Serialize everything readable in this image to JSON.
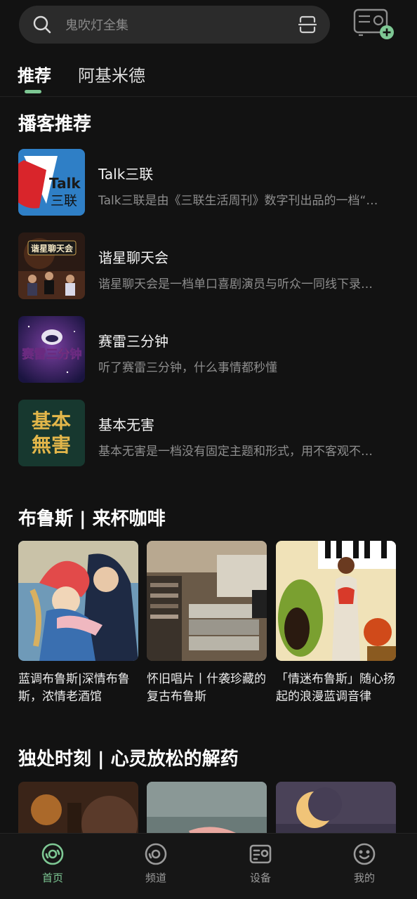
{
  "search": {
    "placeholder": "鬼吹灯全集"
  },
  "tabs": [
    {
      "label": "推荐",
      "active": true
    },
    {
      "label": "阿基米德",
      "active": false
    }
  ],
  "podcast_section": {
    "title": "播客推荐",
    "items": [
      {
        "title": "Talk三联",
        "desc": "Talk三联是由《三联生活周刊》数字刊出品的一档“…",
        "cover_text": "Talk三联"
      },
      {
        "title": "谐星聊天会",
        "desc": "谐星聊天会是一档单口喜剧演员与听众一同线下录…",
        "cover_text": "谐星聊天会"
      },
      {
        "title": "赛雷三分钟",
        "desc": "听了赛雷三分钟，什么事情都秒懂",
        "cover_text": "赛雷三分钟"
      },
      {
        "title": "基本无害",
        "desc": "基本无害是一档没有固定主题和形式，用不客观不…",
        "cover_text_line1": "基本",
        "cover_text_line2": "無害"
      }
    ]
  },
  "blues_section": {
    "title": "布鲁斯 | 来杯咖啡",
    "cards": [
      {
        "title": "蓝调布鲁斯|深情布鲁斯，浓情老酒馆"
      },
      {
        "title": "怀旧唱片丨什袭珍藏的复古布鲁斯"
      },
      {
        "title": "「情迷布鲁斯」随心扬起的浪漫蓝调音律"
      }
    ]
  },
  "alone_section": {
    "title": "独处时刻 | 心灵放松的解药"
  },
  "bottom_nav": [
    {
      "label": "首页",
      "icon": "home-disc-icon",
      "active": true
    },
    {
      "label": "频道",
      "icon": "channel-disc-icon",
      "active": false
    },
    {
      "label": "设备",
      "icon": "radio-device-icon",
      "active": false
    },
    {
      "label": "我的",
      "icon": "smiley-profile-icon",
      "active": false
    }
  ],
  "colors": {
    "accent": "#7ec894",
    "background": "#121212"
  }
}
